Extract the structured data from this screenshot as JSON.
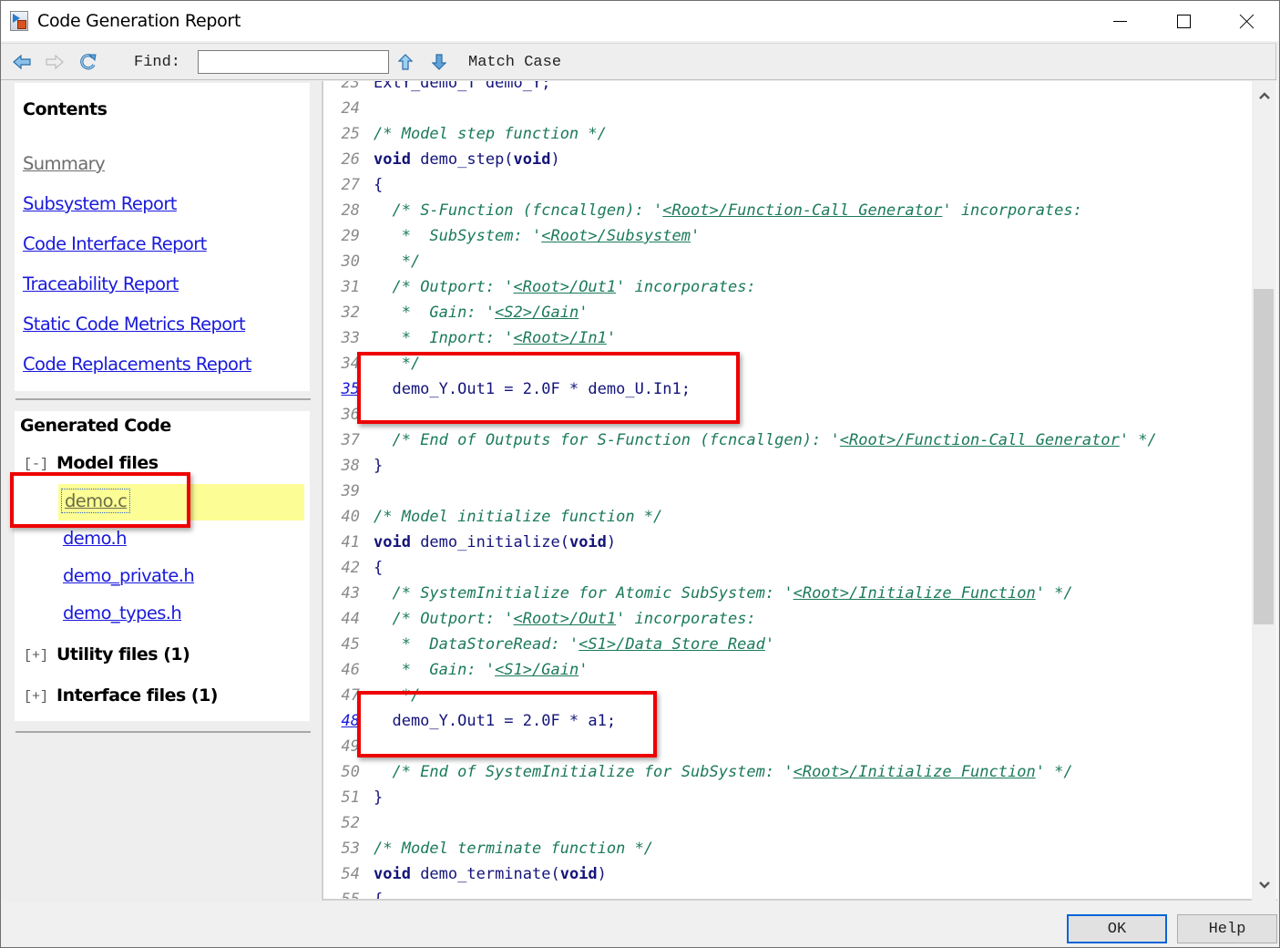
{
  "window": {
    "title": "Code Generation Report",
    "controls": [
      "minimize",
      "maximize",
      "close"
    ]
  },
  "toolbar": {
    "back_icon": "arrow-left-icon",
    "forward_icon": "arrow-right-icon",
    "refresh_icon": "refresh-icon",
    "find_label": "Find:",
    "find_value": "",
    "find_placeholder": "",
    "find_prev_icon": "arrow-up-icon",
    "find_next_icon": "arrow-down-icon",
    "match_case_label": "Match Case"
  },
  "nav": {
    "contents_heading": "Contents",
    "contents_links": [
      {
        "label": "Summary",
        "visited": true
      },
      {
        "label": "Subsystem Report",
        "visited": false
      },
      {
        "label": "Code Interface Report",
        "visited": false
      },
      {
        "label": "Traceability Report",
        "visited": false
      },
      {
        "label": "Static Code Metrics Report",
        "visited": false
      },
      {
        "label": "Code Replacements Report",
        "visited": false
      }
    ],
    "generated_heading": "Generated Code",
    "groups": [
      {
        "toggle": "[-]",
        "label": "Model files",
        "expanded": true,
        "files": [
          "demo.c",
          "demo.h",
          "demo_private.h",
          "demo_types.h"
        ],
        "active_file": "demo.c"
      },
      {
        "toggle": "[+]",
        "label": "Utility files (1)",
        "expanded": false
      },
      {
        "toggle": "[+]",
        "label": "Interface files (1)",
        "expanded": false
      }
    ]
  },
  "code": {
    "file": "demo.c",
    "lines": [
      {
        "n": "23",
        "text": "ExtY_demo_T demo_Y;"
      },
      {
        "n": "24",
        "text": ""
      },
      {
        "n": "25",
        "text": "/* Model step function */"
      },
      {
        "n": "26",
        "text": "void demo_step(void)"
      },
      {
        "n": "27",
        "text": "{"
      },
      {
        "n": "28",
        "text": "  /* S-Function (fcncallgen): '<Root>/Function-Call Generator' incorporates:"
      },
      {
        "n": "29",
        "text": "   *  SubSystem: '<Root>/Subsystem'"
      },
      {
        "n": "30",
        "text": "   */"
      },
      {
        "n": "31",
        "text": "  /* Outport: '<Root>/Out1' incorporates:"
      },
      {
        "n": "32",
        "text": "   *  Gain: '<S2>/Gain'"
      },
      {
        "n": "33",
        "text": "   *  Inport: '<Root>/In1'"
      },
      {
        "n": "34",
        "text": "   */"
      },
      {
        "n": "35",
        "text": "  demo_Y.Out1 = 2.0F * demo_U.In1;",
        "linked": true
      },
      {
        "n": "36",
        "text": ""
      },
      {
        "n": "37",
        "text": "  /* End of Outputs for S-Function (fcncallgen): '<Root>/Function-Call Generator' */"
      },
      {
        "n": "38",
        "text": "}"
      },
      {
        "n": "39",
        "text": ""
      },
      {
        "n": "40",
        "text": "/* Model initialize function */"
      },
      {
        "n": "41",
        "text": "void demo_initialize(void)"
      },
      {
        "n": "42",
        "text": "{"
      },
      {
        "n": "43",
        "text": "  /* SystemInitialize for Atomic SubSystem: '<Root>/Initialize Function' */"
      },
      {
        "n": "44",
        "text": "  /* Outport: '<Root>/Out1' incorporates:"
      },
      {
        "n": "45",
        "text": "   *  DataStoreRead: '<S1>/Data Store Read'"
      },
      {
        "n": "46",
        "text": "   *  Gain: '<S1>/Gain'"
      },
      {
        "n": "47",
        "text": "   */"
      },
      {
        "n": "48",
        "text": "  demo_Y.Out1 = 2.0F * a1;",
        "linked": true
      },
      {
        "n": "49",
        "text": ""
      },
      {
        "n": "50",
        "text": "  /* End of SystemInitialize for SubSystem: '<Root>/Initialize Function' */"
      },
      {
        "n": "51",
        "text": "}"
      },
      {
        "n": "52",
        "text": ""
      },
      {
        "n": "53",
        "text": "/* Model terminate function */"
      },
      {
        "n": "54",
        "text": "void demo_terminate(void)"
      },
      {
        "n": "55",
        "text": "{"
      }
    ]
  },
  "scrollbar": {
    "position_fraction": 0.42
  },
  "annotations": [
    {
      "target": "code-line-35",
      "color": "#ee0000"
    },
    {
      "target": "code-line-48",
      "color": "#ee0000"
    },
    {
      "target": "file-demo.c",
      "color": "#ee0000"
    }
  ],
  "buttons": {
    "ok_label": "OK",
    "help_label": "Help"
  },
  "colors": {
    "link": "#1a1adb",
    "visited_link": "#6d6d6d",
    "comment": "#1b7a5a",
    "code_text": "#13137a",
    "highlight": "#fdfd96",
    "annotation": "#ee0000"
  }
}
